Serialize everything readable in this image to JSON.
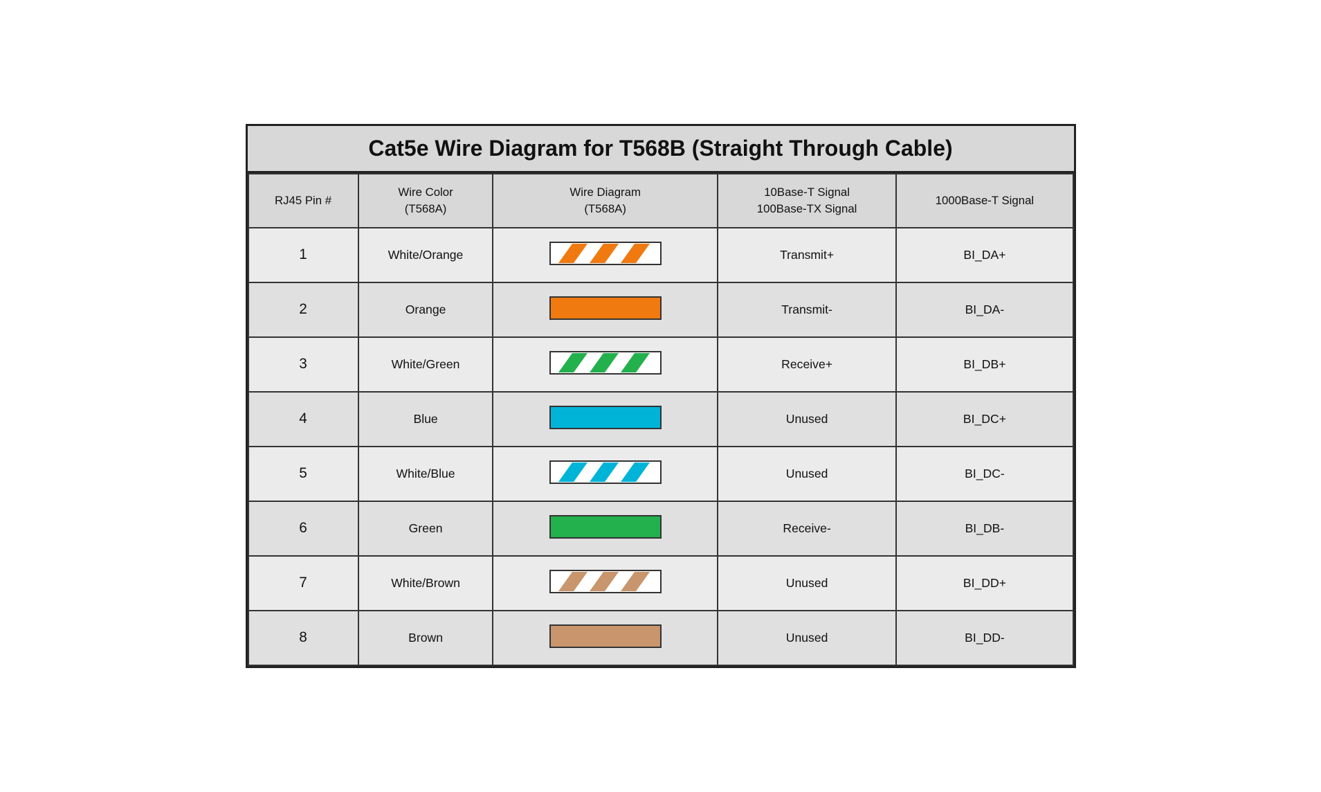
{
  "title": "Cat5e Wire Diagram for T568B (Straight Through Cable)",
  "headers": {
    "pin": "RJ45 Pin #",
    "color": "Wire Color\n(T568A)",
    "diagram": "Wire Diagram\n(T568A)",
    "signal_10_100": "10Base-T Signal\n100Base-TX Signal",
    "signal_1000": "1000Base-T Signal"
  },
  "rows": [
    {
      "pin": "1",
      "color": "White/Orange",
      "wire_type": "striped",
      "stripe_color": "#F07A10",
      "signal_10_100": "Transmit+",
      "signal_1000": "BI_DA+"
    },
    {
      "pin": "2",
      "color": "Orange",
      "wire_type": "solid",
      "stripe_color": "#F07A10",
      "signal_10_100": "Transmit-",
      "signal_1000": "BI_DA-"
    },
    {
      "pin": "3",
      "color": "White/Green",
      "wire_type": "striped",
      "stripe_color": "#22B14C",
      "signal_10_100": "Receive+",
      "signal_1000": "BI_DB+"
    },
    {
      "pin": "4",
      "color": "Blue",
      "wire_type": "solid",
      "stripe_color": "#00B4D8",
      "signal_10_100": "Unused",
      "signal_1000": "BI_DC+"
    },
    {
      "pin": "5",
      "color": "White/Blue",
      "wire_type": "striped",
      "stripe_color": "#00B4D8",
      "signal_10_100": "Unused",
      "signal_1000": "BI_DC-"
    },
    {
      "pin": "6",
      "color": "Green",
      "wire_type": "solid",
      "stripe_color": "#22B14C",
      "signal_10_100": "Receive-",
      "signal_1000": "BI_DB-"
    },
    {
      "pin": "7",
      "color": "White/Brown",
      "wire_type": "striped",
      "stripe_color": "#C8956C",
      "signal_10_100": "Unused",
      "signal_1000": "BI_DD+"
    },
    {
      "pin": "8",
      "color": "Brown",
      "wire_type": "solid",
      "stripe_color": "#C8956C",
      "signal_10_100": "Unused",
      "signal_1000": "BI_DD-"
    }
  ]
}
